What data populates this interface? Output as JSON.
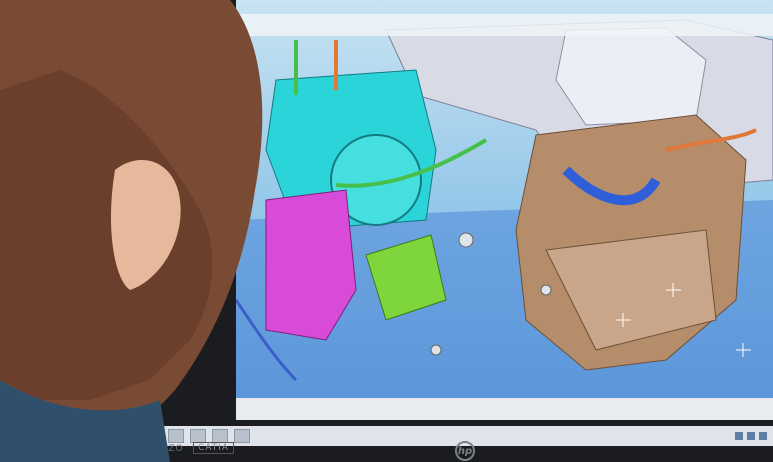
{
  "scene": {
    "description_labels": {
      "monitor_brand": "EIZO",
      "sticker": "CATIA",
      "logo": "hp"
    }
  },
  "cad_window": {
    "menu_items": [
      "",
      "",
      "",
      "",
      ""
    ],
    "status_text": ""
  },
  "colors": {
    "cyan_part": "#2ad4d8",
    "magenta_part": "#d84ad8",
    "bronze_part": "#b58d6a",
    "lime_part": "#7fd63c",
    "gray_part": "#d8dbe6",
    "hair": "#7a4b34",
    "skin": "#e6b89c"
  }
}
